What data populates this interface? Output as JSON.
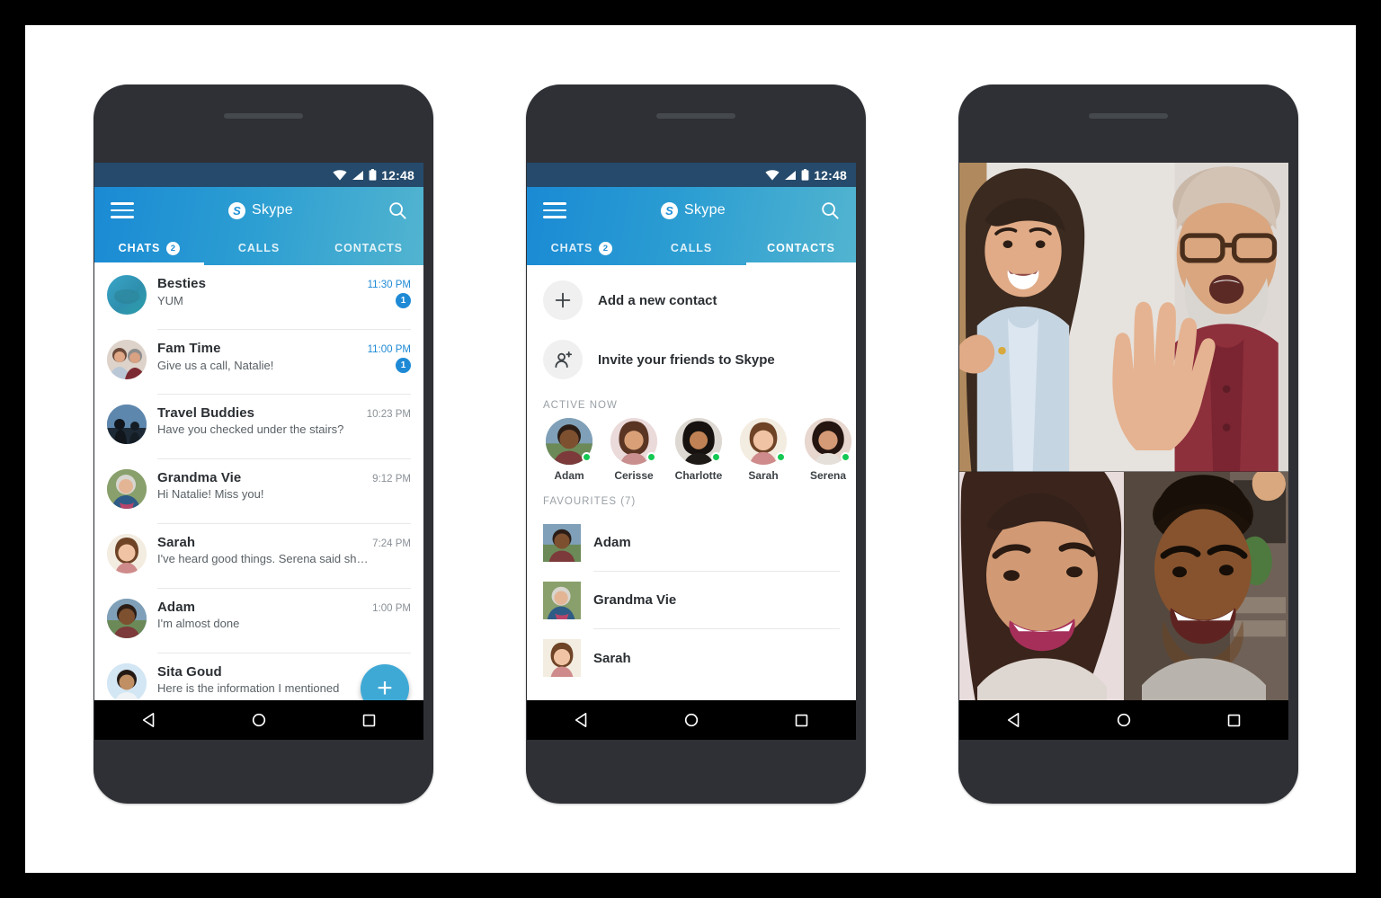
{
  "canvas": {
    "background": "#000000",
    "card_background": "#ffffff"
  },
  "theme": {
    "header_gradient_start": "#1a8ad4",
    "header_gradient_end": "#52b4d0",
    "statusbar": "#254a6b",
    "accent_blue": "#1e8ad6",
    "fab_blue": "#3fa9d6",
    "presence_green": "#14c853",
    "phone_body": "#2e3035"
  },
  "statusbar": {
    "time": "12:48",
    "icons": [
      "wifi-icon",
      "cellular-signal-icon",
      "battery-icon"
    ]
  },
  "header": {
    "menu_icon": "hamburger-menu-icon",
    "brand_mark": "S",
    "brand_name": "Skype",
    "search_icon": "search-icon"
  },
  "navbar": {
    "back_icon": "back-triangle-icon",
    "home_icon": "home-circle-icon",
    "recents_icon": "recents-square-icon"
  },
  "phone1": {
    "tabs": [
      {
        "label": "CHATS",
        "badge": "2",
        "active": true
      },
      {
        "label": "CALLS",
        "badge": null,
        "active": false
      },
      {
        "label": "CONTACTS",
        "badge": null,
        "active": false
      }
    ],
    "fab_label": "+",
    "chats": [
      {
        "name": "Besties",
        "snippet": "YUM",
        "time": "11:30 PM",
        "unread": "1",
        "avatar": "whale-group-avatar"
      },
      {
        "name": "Fam Time",
        "snippet": "Give us a call, Natalie!",
        "time": "11:00 PM",
        "unread": "1",
        "avatar": "family-group-avatar"
      },
      {
        "name": "Travel Buddies",
        "snippet": "Have you checked under the stairs?",
        "time": "10:23 PM",
        "unread": null,
        "avatar": "travel-group-avatar"
      },
      {
        "name": "Grandma Vie",
        "snippet": "Hi Natalie! Miss you!",
        "time": "9:12 PM",
        "unread": null,
        "avatar": "grandma-avatar"
      },
      {
        "name": "Sarah",
        "snippet": "I've heard good things. Serena said she...",
        "time": "7:24 PM",
        "unread": null,
        "avatar": "sarah-avatar"
      },
      {
        "name": "Adam",
        "snippet": "I'm almost done",
        "time": "1:00 PM",
        "unread": null,
        "avatar": "adam-avatar"
      },
      {
        "name": "Sita Goud",
        "snippet": "Here is the information I mentioned",
        "time": "",
        "unread": null,
        "avatar": "sita-avatar"
      }
    ]
  },
  "phone2": {
    "tabs": [
      {
        "label": "CHATS",
        "badge": "2",
        "active": false
      },
      {
        "label": "CALLS",
        "badge": null,
        "active": false
      },
      {
        "label": "CONTACTS",
        "badge": null,
        "active": true
      }
    ],
    "actions": [
      {
        "label": "Add a new contact",
        "icon": "plus-icon"
      },
      {
        "label": "Invite your friends to Skype",
        "icon": "person-add-icon"
      }
    ],
    "active_now_heading": "ACTIVE NOW",
    "active_now": [
      {
        "name": "Adam",
        "online": true,
        "avatar": "adam-avatar"
      },
      {
        "name": "Cerisse",
        "online": true,
        "avatar": "cerisse-avatar"
      },
      {
        "name": "Charlotte",
        "online": true,
        "avatar": "charlotte-avatar"
      },
      {
        "name": "Sarah",
        "online": true,
        "avatar": "sarah-avatar"
      },
      {
        "name": "Serena",
        "online": true,
        "avatar": "serena-avatar"
      }
    ],
    "favourites_heading": "FAVOURITES (7)",
    "favourites": [
      {
        "name": "Adam",
        "avatar": "adam-avatar"
      },
      {
        "name": "Grandma Vie",
        "avatar": "grandma-avatar"
      },
      {
        "name": "Sarah",
        "avatar": "sarah-avatar"
      }
    ]
  },
  "phone3": {
    "screen_name": "group-video-call",
    "tiles": [
      {
        "id": "tile-couple-waving",
        "description": "Woman laughing and man with glasses waving"
      },
      {
        "id": "tile-woman-smiling",
        "description": "Woman with curly hair smiling"
      },
      {
        "id": "tile-man-smiling",
        "description": "Man smiling in front of bookshelf"
      }
    ]
  }
}
